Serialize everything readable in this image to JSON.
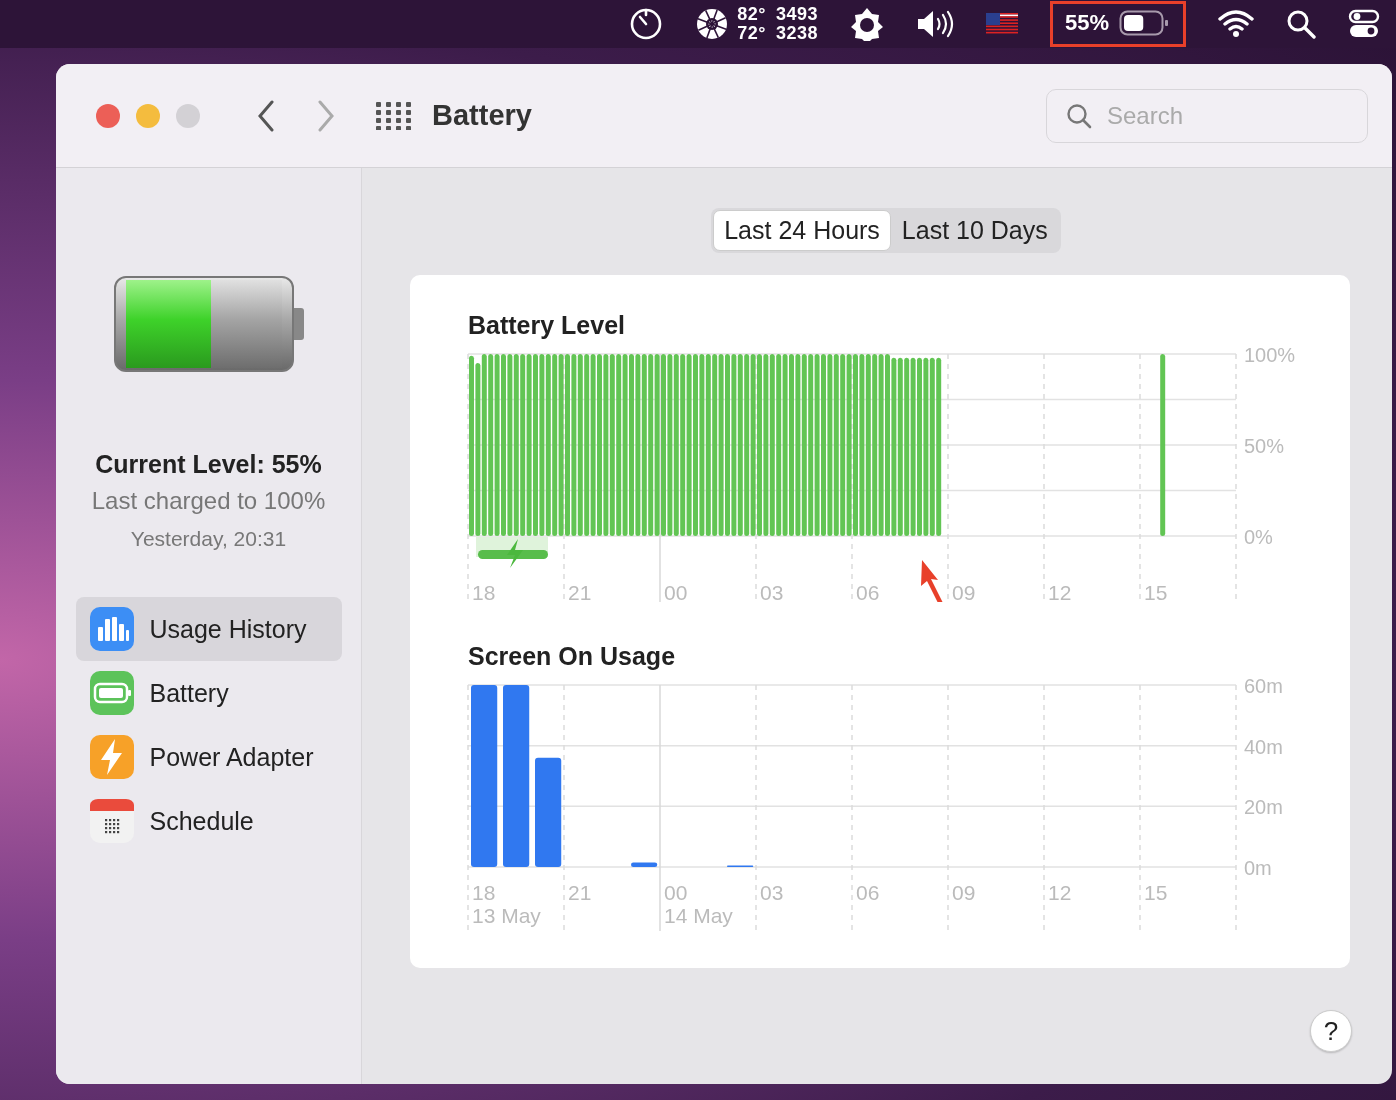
{
  "menu_bar": {
    "items": [
      {
        "kind": "timer"
      },
      {
        "kind": "fan",
        "readings": [
          {
            "temp": "82°",
            "rpm": "3493"
          },
          {
            "temp": "72°",
            "rpm": "3238"
          }
        ]
      },
      {
        "kind": "brightness"
      },
      {
        "kind": "volume"
      },
      {
        "kind": "flag"
      },
      {
        "kind": "battery",
        "text": "55%",
        "level": 0.55,
        "highlighted": true
      },
      {
        "kind": "wifi"
      },
      {
        "kind": "search"
      },
      {
        "kind": "control-center"
      }
    ]
  },
  "window": {
    "title": "Battery",
    "search": {
      "placeholder": "Search"
    }
  },
  "sidebar": {
    "battery": {
      "level": 0.55
    },
    "current_level": "Current Level: 55%",
    "last_charged": "Last charged to 100%",
    "charged_time": "Yesterday, 20:31",
    "items": [
      {
        "kind": "usage",
        "label": "Usage History",
        "selected": true
      },
      {
        "kind": "battery",
        "label": "Battery",
        "selected": false
      },
      {
        "kind": "adapter",
        "label": "Power Adapter",
        "selected": false
      },
      {
        "kind": "schedule",
        "label": "Schedule",
        "selected": false
      }
    ]
  },
  "segments": [
    {
      "label": "Last 24 Hours",
      "selected": true
    },
    {
      "label": "Last 10 Days",
      "selected": false
    }
  ],
  "charts": [
    {
      "title": "Battery Level",
      "charging_shown": true,
      "callout_arrow": {
        "color": "#e8402a"
      },
      "chart_data": {
        "type": "bar",
        "categories": [
          null,
          null,
          "18",
          null,
          null,
          null,
          null,
          null,
          null,
          null,
          null,
          null,
          null,
          null,
          null,
          null,
          null,
          "21",
          null,
          null,
          null,
          null,
          null,
          null,
          null,
          null,
          null,
          null,
          null,
          null,
          null,
          null,
          "00",
          null,
          null,
          null,
          null,
          null,
          null,
          null,
          null,
          null,
          null,
          null,
          null,
          null,
          null,
          "03",
          null,
          null,
          null,
          null,
          null,
          null,
          null,
          null,
          null,
          null,
          null,
          null,
          null,
          null,
          "06",
          null,
          null,
          null,
          null,
          null,
          null,
          null,
          null,
          null,
          null,
          null,
          null,
          null,
          null,
          "09",
          null,
          null,
          null,
          null,
          null,
          null,
          null,
          null,
          null,
          null,
          null,
          null,
          null,
          null,
          "12",
          null,
          null,
          null,
          null,
          null,
          null,
          null,
          null,
          null,
          null,
          null,
          null,
          null,
          null,
          "15",
          null,
          null,
          null,
          null,
          null,
          null,
          null,
          null,
          null,
          null,
          null,
          null
        ],
        "series": [
          {
            "color": "#62c554",
            "values": [
              99,
              95,
              100,
              100,
              100,
              100,
              100,
              100,
              100,
              100,
              100,
              100,
              100,
              100,
              100,
              100,
              100,
              100,
              100,
              100,
              100,
              100,
              100,
              100,
              100,
              100,
              100,
              100,
              100,
              100,
              100,
              100,
              100,
              100,
              100,
              100,
              100,
              100,
              100,
              100,
              100,
              100,
              100,
              100,
              100,
              100,
              100,
              100,
              100,
              100,
              100,
              100,
              100,
              100,
              100,
              100,
              100,
              100,
              100,
              100,
              100,
              100,
              100,
              100,
              100,
              100,
              98,
              98,
              98,
              98,
              98,
              98,
              98,
              98,
              null,
              null,
              null,
              null,
              null,
              null,
              null,
              null,
              null,
              null,
              null,
              null,
              null,
              null,
              null,
              null,
              null,
              null,
              null,
              null,
              null,
              null,
              null,
              null,
              null,
              null,
              null,
              null,
              null,
              null,
              null,
              null,
              null,
              null,
              100,
              null,
              null,
              null,
              null,
              null,
              null,
              null,
              null,
              null,
              null,
              null
            ]
          }
        ],
        "ylim": [
          0,
          100
        ],
        "yticks": [
          {
            "value": 0,
            "label": "0%"
          },
          {
            "value": 50,
            "label": "50%"
          },
          {
            "value": 100,
            "label": "100%"
          }
        ]
      }
    },
    {
      "title": "Screen On Usage",
      "date_labels": [
        "13 May",
        "14 May"
      ],
      "chart_data": {
        "type": "bar",
        "categories": [
          "18",
          null,
          null,
          "21",
          null,
          null,
          "00",
          null,
          null,
          "03",
          null,
          null,
          "06",
          null,
          null,
          "09",
          null,
          null,
          "12",
          null,
          null,
          "15",
          null,
          null
        ],
        "series": [
          {
            "color": "#3078f0",
            "values": [
              60,
              60,
              36,
              0,
              0,
              1.5,
              0,
              0,
              0.3,
              0,
              0,
              0,
              0,
              0,
              0,
              0,
              0,
              0,
              0,
              0,
              0,
              0,
              0,
              0
            ]
          }
        ],
        "ylim": [
          0,
          60
        ],
        "yticks": [
          {
            "value": 0,
            "label": "0m"
          },
          {
            "value": 20,
            "label": "20m"
          },
          {
            "value": 40,
            "label": "40m"
          },
          {
            "value": 60,
            "label": "60m"
          }
        ]
      }
    }
  ],
  "help": {
    "text": "?"
  }
}
